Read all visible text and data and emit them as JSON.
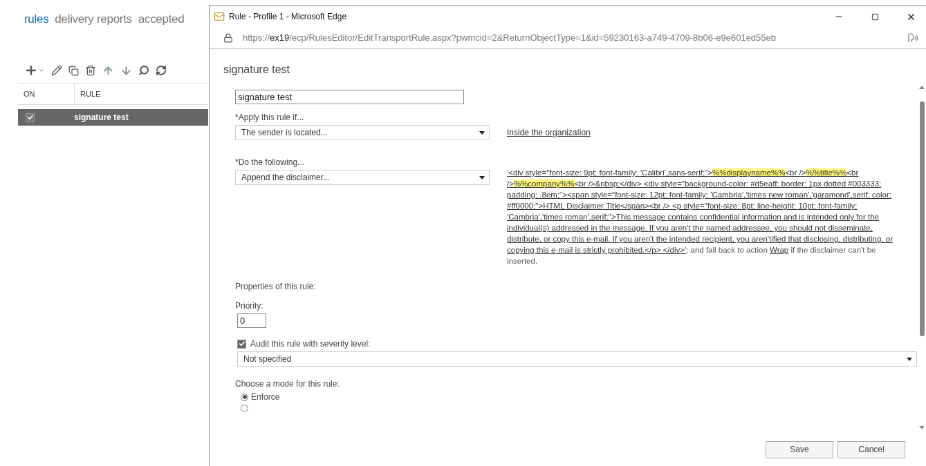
{
  "nav_tabs": [
    {
      "label": "rules",
      "selected": true
    },
    {
      "label": "delivery reports",
      "selected": false
    },
    {
      "label": "accepted",
      "selected": false
    }
  ],
  "rules_table": {
    "columns": [
      "ON",
      "RULE"
    ],
    "rows": [
      {
        "on": true,
        "name": "signature test",
        "selected": true
      }
    ]
  },
  "window": {
    "title": "Rule - Profile 1 - Microsoft Edge",
    "url": {
      "scheme": "https://",
      "host": "ex19",
      "path": "/ecp/RulesEditor/EditTransportRule.aspx?pwmcid=2&ReturnObjectType=1&id=59230163-a749-4709-8b06-e9e601ed55eb"
    }
  },
  "dialog": {
    "heading": "signature test",
    "name_value": "signature test",
    "condition": {
      "label": "*Apply this rule if...",
      "value": "The sender is located...",
      "link": "Inside the organization"
    },
    "action": {
      "label": "*Do the following...",
      "value": "Append the disclaimer...",
      "segments": [
        {
          "text": "'<div style=\"font-size: 9pt; font-family: 'Calibri',sans-serif;\">",
          "highlighted": false
        },
        {
          "text": "%%displayname%%",
          "highlighted": true
        },
        {
          "text": "<br />",
          "highlighted": false
        },
        {
          "text": "%%title%%",
          "highlighted": true
        },
        {
          "text": "<br />",
          "highlighted": false
        },
        {
          "text": "%%company%%",
          "highlighted": true
        },
        {
          "text": "<br />&nbsp;</div>  <div style=\"background-color: #d5eaff; border: 1px dotted #003333; padding: .8em;\"><span style=\"font-size: 12pt; font-family: 'Cambria','times new roman','garamond',serif; color: #ff0000;\">HTML Disclaimer Title</span><br />  <p style=\"font-size: 8pt; line-height: 10pt; font-family: 'Cambria','times roman',serif;\">This message contains confidential information and is intended only for the individual(s) addressed in the message. If you aren't the named addressee, you should not disseminate, distribute, or copy this e-mail. If you aren't the intended recipient, you aren'tified that disclosing, distributing, or copying this e-mail is strictly prohibited.</p>  </div>'",
          "highlighted": false
        }
      ],
      "fallback_prefix": "; and fall back to action ",
      "fallback_link": "Wrap",
      "fallback_suffix": " if the disclaimer can't be inserted."
    },
    "properties_label": "Properties of this rule:",
    "priority": {
      "label": "Priority:",
      "value": "0"
    },
    "audit": {
      "label": "Audit this rule with severity level:",
      "checked": true,
      "severity": "Not specified"
    },
    "mode": {
      "label": "Choose a mode for this rule:",
      "options": [
        {
          "label": "Enforce",
          "selected": true
        },
        {
          "selected": false
        }
      ]
    },
    "buttons": [
      "Save",
      "Cancel"
    ]
  }
}
